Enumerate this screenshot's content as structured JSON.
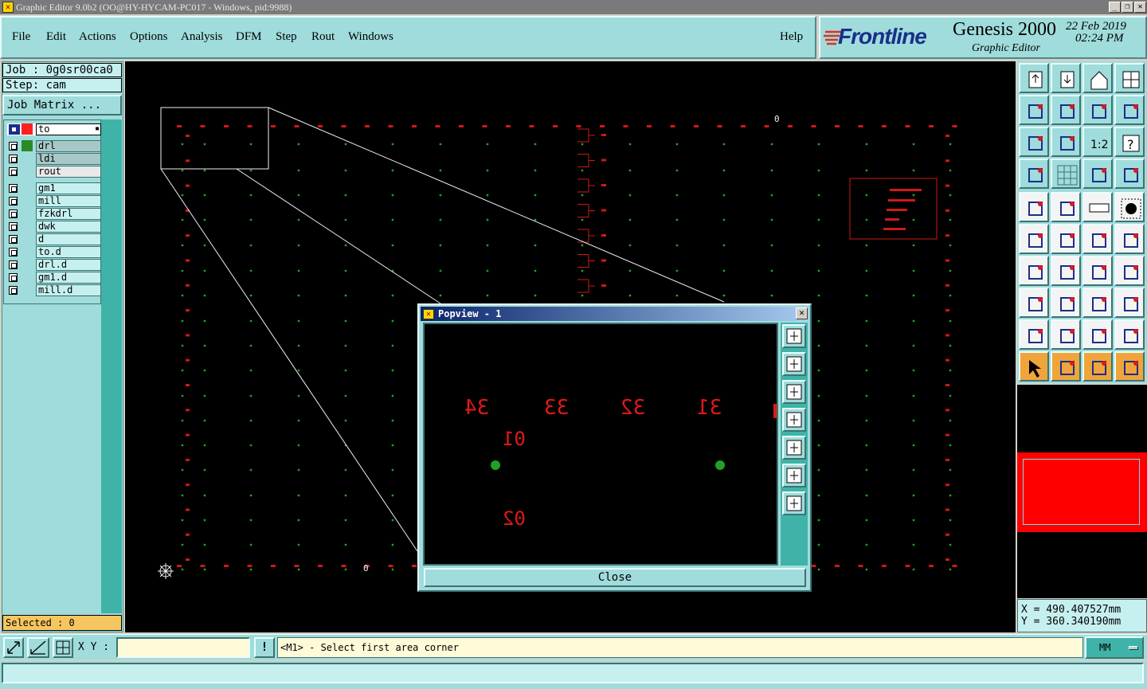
{
  "titlebar": {
    "title": "Graphic Editor 9.0b2 (OO@HY-HYCAM-PC017 - Windows, pid:9988)",
    "min": "_",
    "max": "❐",
    "close": "✕"
  },
  "menu": {
    "file": "File",
    "edit": "Edit",
    "actions": "Actions",
    "options": "Options",
    "analysis": "Analysis",
    "dfm": "DFM",
    "step": "Step",
    "rout": "Rout",
    "windows": "Windows",
    "help": "Help"
  },
  "brand": {
    "logo": "Frontline",
    "product": "Genesis 2000",
    "subtitle": "Graphic Editor",
    "date": "22 Feb 2019",
    "time": "02:24 PM"
  },
  "job": {
    "job_label": "Job : 0g0sr00ca0",
    "step_label": "Step: cam",
    "matrix_button": "Job Matrix ..."
  },
  "layers": {
    "work": {
      "name": "to",
      "color": "#ff2020"
    },
    "group1": [
      {
        "name": "drl",
        "color": "#2a8a2a"
      },
      {
        "name": "ldi",
        "color": ""
      },
      {
        "name": "rout",
        "color": ""
      }
    ],
    "group2": [
      {
        "name": "gm1"
      },
      {
        "name": "mill"
      },
      {
        "name": "fzkdrl"
      },
      {
        "name": "dwk"
      },
      {
        "name": "d"
      },
      {
        "name": "to.d"
      },
      {
        "name": "drl.d"
      },
      {
        "name": "gm1.d"
      },
      {
        "name": "mill.d"
      }
    ]
  },
  "selected": "Selected : 0",
  "coords": {
    "x": "X  =  490.407527mm",
    "y": "Y  =  360.340190mm"
  },
  "statusbar": {
    "xy_label": "X Y :",
    "xy_value": "",
    "alert": "!",
    "message": "<M1> - Select first area corner",
    "units": "MM"
  },
  "popview": {
    "title": "Popview - 1",
    "labels_top": [
      "34",
      "33",
      "32",
      "31"
    ],
    "label_a": "01",
    "label_b": "02",
    "close_label": "Close"
  },
  "canvas": {
    "origin_marker": "0",
    "corner_marker": "0"
  },
  "colors": {
    "panel": "#9fdcdb",
    "field": "#c6f0ef",
    "feature_red": "#e01818",
    "drill_green": "#22a022"
  }
}
